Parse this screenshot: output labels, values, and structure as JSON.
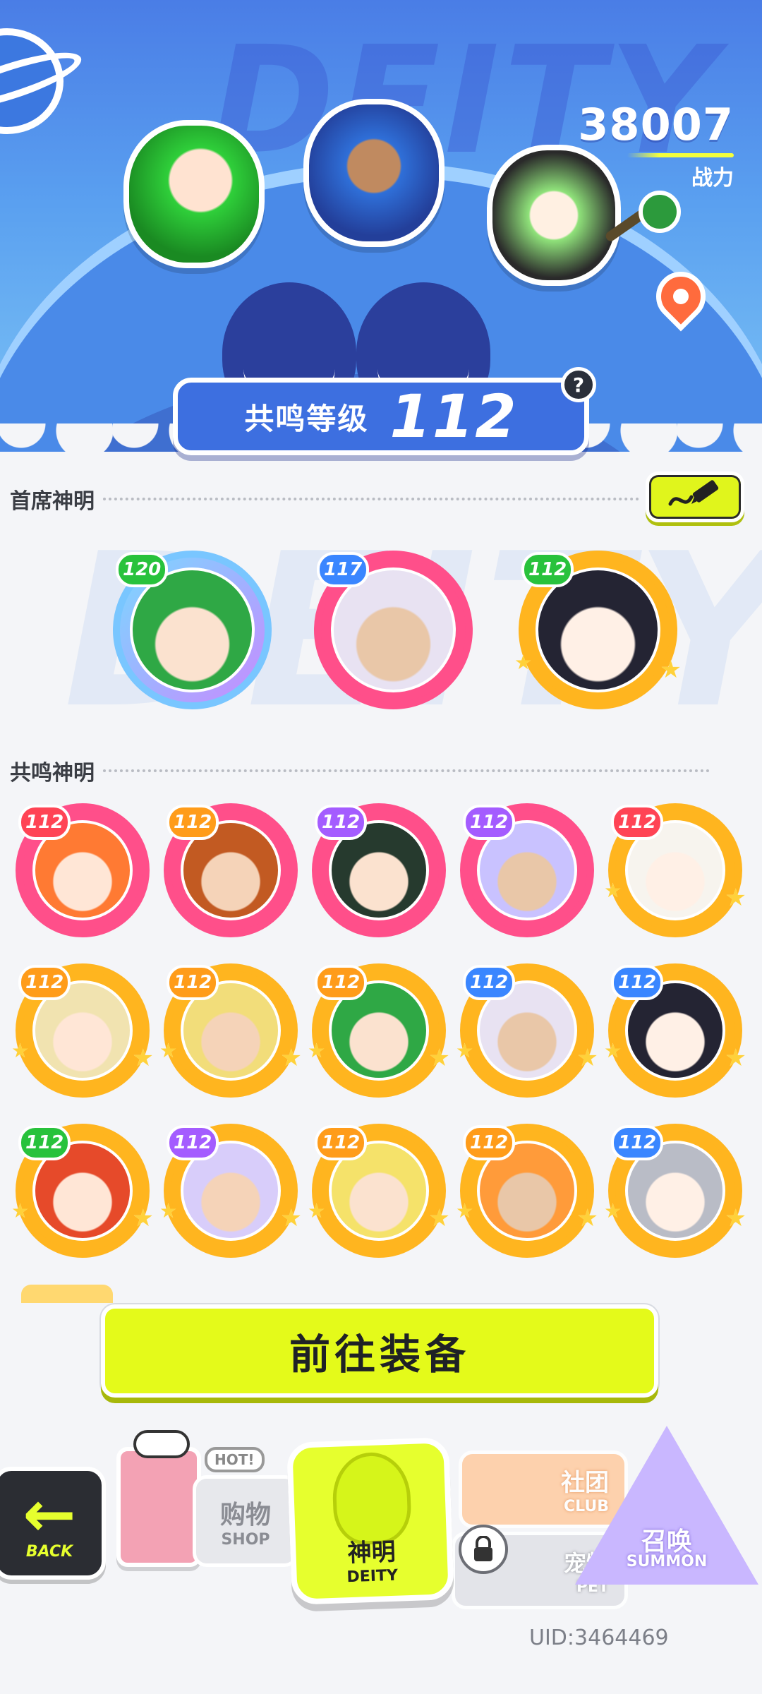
{
  "hero": {
    "watermark": "DEITY",
    "power_value": "38007",
    "power_label": "战力",
    "resonance_label": "共鸣等级",
    "resonance_level": "112",
    "help_glyph": "?",
    "icons": [
      "planet-icon",
      "location-pin-icon",
      "help-icon"
    ]
  },
  "sections": {
    "primary_title": "首席神明",
    "resonance_title": "共鸣神明",
    "edit_icon": "pencil-icon"
  },
  "primary_deities": [
    {
      "level": "120",
      "ring": "cyan",
      "badge": "green"
    },
    {
      "level": "117",
      "ring": "pink",
      "badge": "blue"
    },
    {
      "level": "112",
      "ring": "gold",
      "badge": "green"
    }
  ],
  "resonance_deities": [
    {
      "level": "112",
      "ring": "pink",
      "badge": "red"
    },
    {
      "level": "112",
      "ring": "pink",
      "badge": "orange"
    },
    {
      "level": "112",
      "ring": "pink",
      "badge": "purple"
    },
    {
      "level": "112",
      "ring": "pink",
      "badge": "purple"
    },
    {
      "level": "112",
      "ring": "gold",
      "badge": "red"
    },
    {
      "level": "112",
      "ring": "gold",
      "badge": "orange"
    },
    {
      "level": "112",
      "ring": "gold",
      "badge": "orange"
    },
    {
      "level": "112",
      "ring": "gold",
      "badge": "orange"
    },
    {
      "level": "112",
      "ring": "gold",
      "badge": "blue"
    },
    {
      "level": "112",
      "ring": "gold",
      "badge": "blue"
    },
    {
      "level": "112",
      "ring": "gold",
      "badge": "green"
    },
    {
      "level": "112",
      "ring": "gold",
      "badge": "purple"
    },
    {
      "level": "112",
      "ring": "gold",
      "badge": "orange"
    },
    {
      "level": "112",
      "ring": "gold",
      "badge": "orange"
    },
    {
      "level": "112",
      "ring": "gold",
      "badge": "blue"
    }
  ],
  "equip_button": "前往装备",
  "nav": {
    "back_label": "BACK",
    "shop_label": "购物",
    "shop_sub": "SHOP",
    "hot_badge": "HOT!",
    "deity_label": "神明",
    "deity_sub": "DEITY",
    "club_label": "社团",
    "club_sub": "CLUB",
    "pet_label": "宠物",
    "pet_sub": "PET",
    "summon_label": "召唤",
    "summon_sub": "SUMMON"
  },
  "uid": "UID:3464469",
  "colors": {
    "accent_lime": "#e4fa1a",
    "hero_blue": "#4a7de6",
    "ring_pink": "#ff4f8a",
    "ring_gold": "#ffb51f"
  }
}
